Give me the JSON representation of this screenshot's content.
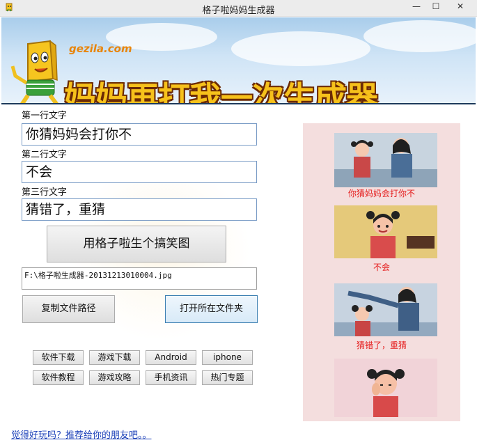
{
  "window": {
    "title": "格子啦妈妈生成器",
    "min_glyph": "—",
    "max_glyph": "☐",
    "close_glyph": "✕"
  },
  "banner": {
    "logo_text": "gezila.com",
    "title": "妈妈再打我一次生成器"
  },
  "form": {
    "line1_label": "第一行文字",
    "line1_value": "你猜妈妈会打你不",
    "line2_label": "第二行文字",
    "line2_value": "不会",
    "line3_label": "第三行文字",
    "line3_value": "猜错了，重猜",
    "generate_button": "用格子啦生个搞笑图",
    "file_path": "F:\\格子啦生成器-20131213010004.jpg",
    "copy_path_button": "复制文件路径",
    "open_folder_button": "打开所在文件夹"
  },
  "links": {
    "row1": [
      "软件下载",
      "游戏下载",
      "Android",
      "iphone"
    ],
    "row2": [
      "软件教程",
      "游戏攻略",
      "手机资讯",
      "热门专题"
    ],
    "share": "觉得好玩吗？推荐给你的朋友吧。。"
  },
  "preview": {
    "caption1": "你猜妈妈会打你不",
    "caption2": "不会",
    "caption3": "猜错了，重猜"
  },
  "colors": {
    "accent_blue": "#1a3fb8",
    "caption_red": "#e51a1a",
    "banner_title": "#f6c11b"
  }
}
